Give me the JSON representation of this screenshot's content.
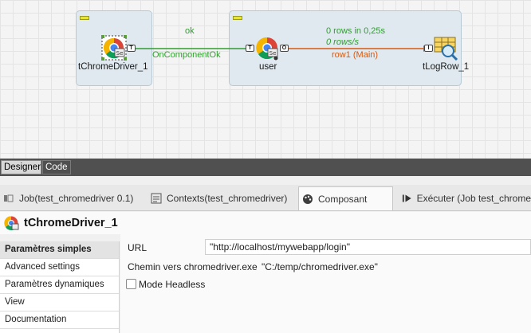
{
  "designer": {
    "components": {
      "chrome_driver": {
        "label": "tChromeDriver_1",
        "icon": "chrome-driver-icon"
      },
      "user": {
        "label": "user",
        "icon": "chrome-selenium-icon"
      },
      "log_row": {
        "label": "tLogRow_1",
        "icon": "log-row-icon"
      }
    },
    "links": {
      "ok": {
        "title": "ok",
        "label": "OnComponentOk"
      },
      "row": {
        "stats_rows": "0 rows in 0,25s",
        "stats_rate": "0 rows/s",
        "label": "row1 (Main)"
      }
    },
    "ports": {
      "trigger": "T",
      "output": "O",
      "input": "I"
    }
  },
  "mode_tabs": [
    {
      "label": "Designer",
      "active": true
    },
    {
      "label": "Code",
      "active": false
    }
  ],
  "view_tabs": [
    {
      "label": "Job(test_chromedriver 0.1)",
      "icon": "job-icon"
    },
    {
      "label": "Contexts(test_chromedriver)",
      "icon": "contexts-icon"
    },
    {
      "label": "Composant",
      "icon": "component-palette-icon",
      "active": true
    },
    {
      "label": "Exécuter (Job test_chrome",
      "icon": "run-icon"
    }
  ],
  "component_title": "tChromeDriver_1",
  "settings_menu": [
    {
      "label": "Paramètres simples",
      "active": true
    },
    {
      "label": "Advanced settings"
    },
    {
      "label": "Paramètres dynamiques"
    },
    {
      "label": "View"
    },
    {
      "label": "Documentation"
    }
  ],
  "form": {
    "url_label": "URL",
    "url_value": "\"http://localhost/mywebapp/login\"",
    "driver_label": "Chemin vers chromedriver.exe",
    "driver_value": "\"C:/temp/chromedriver.exe\"",
    "headless_label": "Mode Headless",
    "headless_checked": false
  },
  "colors": {
    "ok_link": "#2f9e2f",
    "row_link": "#d9580f",
    "subjob_bg": "#dfe9ef",
    "mode_bar": "#505050"
  }
}
